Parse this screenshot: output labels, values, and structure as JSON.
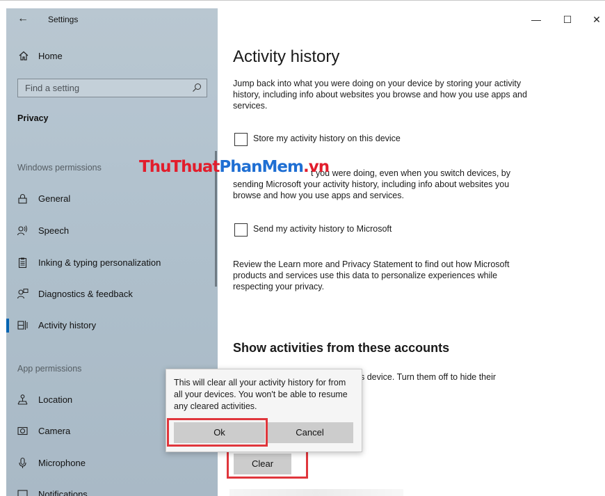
{
  "app": {
    "title": "Settings",
    "back_icon": "back-arrow-icon"
  },
  "window_controls": {
    "minimize": "—",
    "maximize": "☐",
    "close": "✕"
  },
  "sidebar": {
    "home_label": "Home",
    "search_placeholder": "Find a setting",
    "section_title": "Privacy",
    "group_windows": "Windows permissions",
    "group_app": "App permissions",
    "items_windows": [
      {
        "label": "General",
        "icon": "lock-icon"
      },
      {
        "label": "Speech",
        "icon": "speech-icon"
      },
      {
        "label": "Inking & typing personalization",
        "icon": "clipboard-icon"
      },
      {
        "label": "Diagnostics & feedback",
        "icon": "feedback-icon"
      },
      {
        "label": "Activity history",
        "icon": "activity-history-icon",
        "selected": true
      }
    ],
    "items_app": [
      {
        "label": "Location",
        "icon": "location-icon"
      },
      {
        "label": "Camera",
        "icon": "camera-icon"
      },
      {
        "label": "Microphone",
        "icon": "microphone-icon"
      },
      {
        "label": "Notifications",
        "icon": "notifications-icon"
      }
    ]
  },
  "main": {
    "heading": "Activity history",
    "intro": "Jump back into what you were doing on your device by storing your activity history, including info about websites you browse and how you use apps and services.",
    "checkbox_store": "Store my activity history on this device",
    "sync_text_tail": "t you were doing, even when you switch devices, by",
    "sync_text_rest": "sending Microsoft your activity history, including info about websites you browse and how you use apps and services.",
    "checkbox_send": "Send my activity history to Microsoft",
    "review_text": "Review the Learn more and Privacy Statement to find out how Microsoft products and services use this data to personalize experiences while respecting your privacy.",
    "accounts_heading": "Show activities from these accounts",
    "accounts_text_tail": "s device. Turn them off to hide their",
    "clear_label": "Clear"
  },
  "watermark": {
    "part1": "ThuThuat",
    "part2": "PhanMem",
    "part3": ".vn"
  },
  "dialog": {
    "message": "This will clear all your activity history for from all your devices. You won't be able to resume any cleared activities.",
    "ok_label": "Ok",
    "cancel_label": "Cancel"
  },
  "colors": {
    "accent": "#0063b1",
    "highlight": "#e0363c",
    "watermark_red": "#e21d2c",
    "watermark_blue": "#1f6fd3"
  }
}
